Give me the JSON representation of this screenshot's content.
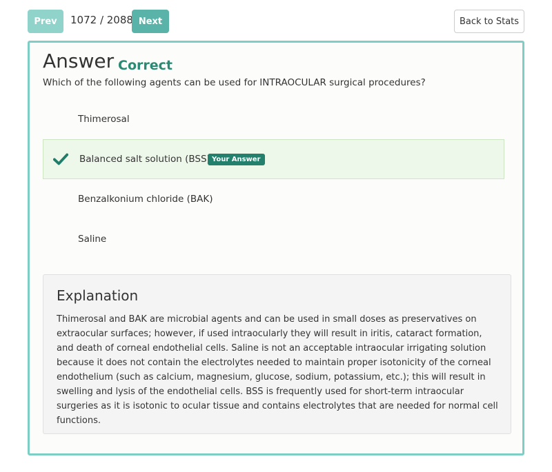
{
  "nav": {
    "prev_label": "Prev",
    "next_label": "Next",
    "position": "1072 / 2088",
    "back_label": "Back to Stats"
  },
  "answer": {
    "title": "Answer",
    "result": "Correct",
    "question": "Which of the following agents can be used for INTRAOCULAR surgical procedures?"
  },
  "choices": [
    {
      "label": "Thimerosal",
      "selected": false
    },
    {
      "label": "Balanced salt solution (BSS)",
      "selected": true,
      "badge": "Your Answer",
      "icon": "checkmark-icon"
    },
    {
      "label": "Benzalkonium chloride (BAK)",
      "selected": false
    },
    {
      "label": "Saline",
      "selected": false
    }
  ],
  "explanation": {
    "title": "Explanation",
    "text": "Thimerosal and BAK are microbial agents and can be used in small doses as preservatives on extraocular surfaces; however, if used intraocularly they will result in iritis, cataract formation, and death of corneal endothelial cells. Saline is not an acceptable intraocular irrigating solution because it does not contain the electrolytes needed to maintain proper isotonicity of the corneal endothelium (such as calcium, magnesium, glucose, sodium, potassium, etc.); this will result in swelling and lysis of the endothelial cells. BSS is frequently used for short-term intraocular surgeries as it is isotonic to ocular tissue and contains electrolytes that are needed for normal cell functions."
  },
  "colors": {
    "accent": "#7ecec5",
    "correct": "#2a8a73",
    "selected_bg": "#eef8ea"
  }
}
